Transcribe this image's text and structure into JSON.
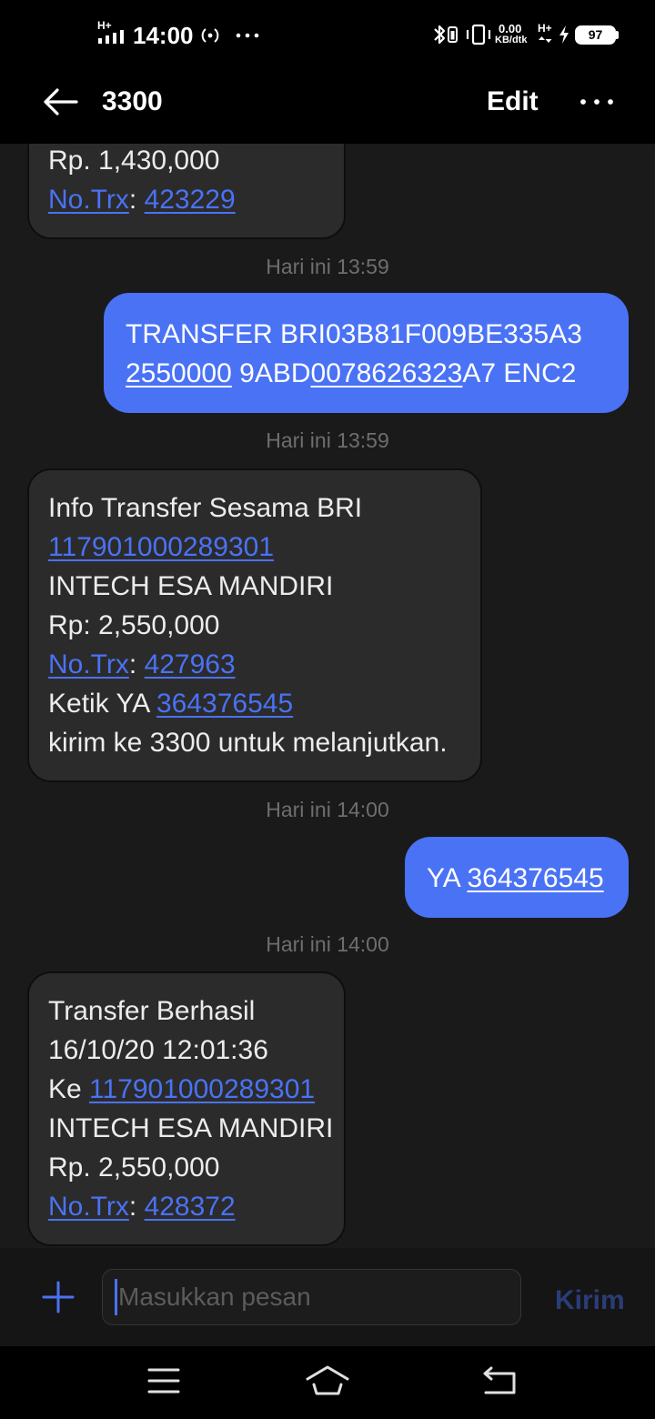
{
  "status_bar": {
    "network_type_left": "H+",
    "time": "14:00",
    "speed_value": "0.00",
    "speed_unit": "KB/dtk",
    "network_type_right": "H+",
    "battery_percent": "97",
    "icons": [
      "signal-icon",
      "hotspot-icon",
      "more-icon",
      "bluetooth-icon",
      "vibrate-icon",
      "data-activity-icon",
      "charging-icon",
      "battery-icon"
    ]
  },
  "header": {
    "title": "3300",
    "edit_label": "Edit",
    "icons": [
      "back-arrow-icon",
      "more-options-icon"
    ]
  },
  "thread": [
    {
      "received": [
        [
          "Rp. 1,430,000"
        ],
        [
          "No.Trx",
          ": ",
          "423229"
        ]
      ]
    },
    {
      "time": "Hari ini 13:59"
    },
    {
      "sent": [
        [
          "TRANSFER BRI03B81F009BE335A3"
        ],
        [
          "2550000",
          " 9ABD",
          "0078626323",
          "A7 ENC2"
        ]
      ]
    },
    {
      "time": "Hari ini 13:59"
    },
    {
      "received": [
        [
          "Info Transfer Sesama BRI"
        ],
        [
          "117901000289301"
        ],
        [
          "INTECH ESA MANDIRI"
        ],
        [
          "Rp: 2,550,000"
        ],
        [
          "No.Trx",
          ": ",
          "427963"
        ],
        [
          "Ketik YA ",
          "364376545"
        ],
        [
          "kirim ke 3300 untuk melanjutkan."
        ]
      ]
    },
    {
      "time": "Hari ini 14:00"
    },
    {
      "sent": [
        [
          "YA ",
          "364376545"
        ]
      ]
    },
    {
      "time": "Hari ini 14:00"
    },
    {
      "received": [
        [
          "Transfer Berhasil"
        ],
        [
          "16/10/20 12:01:36"
        ],
        [
          "Ke ",
          "117901000289301"
        ],
        [
          "INTECH ESA MANDIRI"
        ],
        [
          "Rp. 2,550,000"
        ],
        [
          "No.Trx",
          ": ",
          "428372"
        ]
      ]
    }
  ],
  "composer": {
    "placeholder": "Masukkan pesan",
    "send_label": "Kirim",
    "icons": [
      "add-icon"
    ]
  },
  "nav_bar": {
    "icons": [
      "menu-icon",
      "home-icon",
      "back-icon"
    ]
  },
  "colors": {
    "accent": "#4a72f5",
    "send_disabled": "#2b3d78",
    "received_bubble": "#2b2b2b",
    "sent_bubble": "#4a72f5",
    "thread_background": "#1a1a1a",
    "timestamp": "#6e6e6e"
  }
}
